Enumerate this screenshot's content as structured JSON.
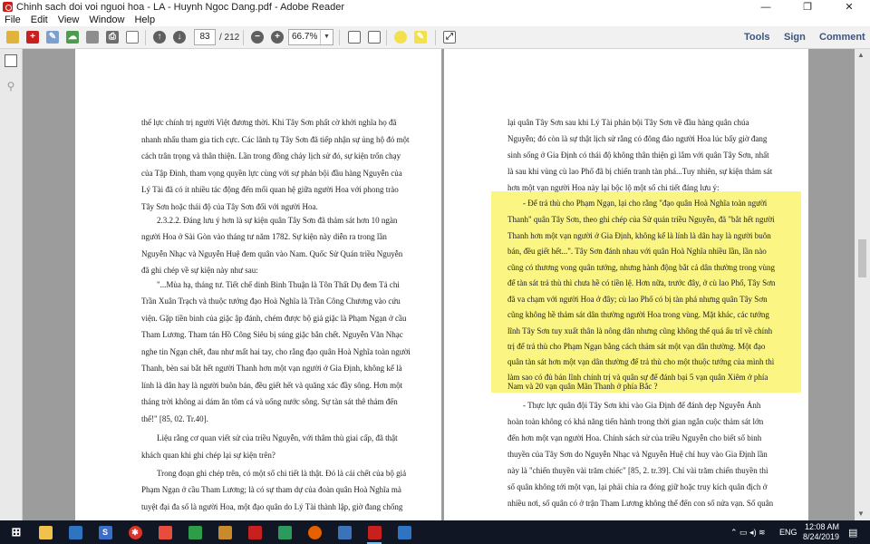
{
  "window": {
    "title": "Chinh sach doi voi nguoi hoa - LA - Huynh Ngoc Dang.pdf - Adobe Reader",
    "controls": {
      "minimize": "—",
      "maximize": "❐",
      "close": "✕"
    }
  },
  "menu": [
    "File",
    "Edit",
    "View",
    "Window",
    "Help"
  ],
  "toolbar": {
    "current_page": "83",
    "total_pages": "/ 212",
    "zoom": "66.7%",
    "tools_label": "Tools",
    "sign_label": "Sign",
    "comment_label": "Comment"
  },
  "colors": {
    "highlight": "#fbf583",
    "pdf_red": "#c8201e",
    "taskbar": "#101623"
  },
  "left_page": [
    "thế lực chính trị người Việt đương thời. Khi Tây Sơn phất cờ khởi nghĩa họ đã",
    "nhanh nhẩu tham gia tích cực. Các lãnh tụ Tây Sơn đã tiếp nhận sự ủng hộ đó một",
    "cách trân trọng và thân thiện. Lần trong đồng chảy lịch sử đó, sự kiện trốn chạy",
    "của Tập Đình, tham vọng quyền lực cùng với sự phản bội đầu hàng Nguyễn của",
    "Lý Tài đã có ít nhiều tác động đến mối quan hệ giữa người Hoa với phong trào",
    "Tây Sơn hoặc thái độ của Tây Sơn đối với người Hoa.",
    "2.3.2.2. Đáng lưu ý hơn là sự kiện quân Tây Sơn đã thảm sát hơn 10 ngàn",
    "người Hoa ở Sài Gòn vào tháng tư năm 1782. Sự kiện này diễn ra trong lần",
    "Nguyễn Nhạc và Nguyễn Huệ đem quân vào Nam. Quốc Sử Quán triều Nguyễn",
    "đã ghi chép về sự kiện này như sau:",
    "\"...Mùa hạ, tháng tư. Tiết chế dinh Bình Thuận là Tôn Thất Dụ đem Tả chi",
    "Trần Xuân Trạch và thuộc tướng đạo Hoà Nghĩa là Trần Công Chương vào cứu",
    "viện. Gặp tiền binh của giặc ập đánh, chém được bộ giả giặc là Phạm Ngạn ở cầu",
    "Tham Lương. Tham tán Hồ Công Siêu bị súng giặc bắn chết. Nguyễn Văn Nhạc",
    "nghe tin Ngạn chết, đau như mất hai tay, cho rằng đạo quân Hoà Nghĩa toàn người",
    "Thanh, bèn sai bắt hết người Thanh hơn một vạn người ở Gia Định, không kể là",
    "lính là dân hay là người buôn bán, đều giết hết và quăng xác đầy sông. Hơn một",
    "tháng trời không ai dám ăn tôm cá và uống nước sông. Sự tàn sát thê thảm đến",
    "thế!\" [85, 02. Tr.40].",
    "Liệu rằng cơ quan viết sử của triều Nguyễn, với thâm thù giai cấp, đã thật",
    "khách quan khi ghi chép lại sự kiện trên?",
    "Trong đoạn ghi chép trên, có một số chi tiết là thật. Đó là cái chết của bộ giả",
    "Phạm Ngạn ở cầu Tham Lương; là có sự tham dự của đoàn quân Hoà Nghĩa mà",
    "tuyệt đại đa số là người Hoa, một đạo quân do Lý Tài thành lập, giờ đang chống"
  ],
  "right_page": [
    "lại quân Tây Sơn sau khi Lý Tài phản bội Tây Sơn về đầu hàng quân chúa",
    "Nguyễn; đó còn là sự thật lịch sử rằng có đông đảo người Hoa lúc bấy giờ đang",
    "sinh sống ở Gia Định có  thái độ không thân thiện gì lắm với quân Tây Sơn, nhất",
    "là sau khi vùng cù lao Phố đã bị chiến tranh tàn phá...Tuy nhiên, sự kiện thảm sát",
    "hơn một vạn người Hoa này lại bộc lộ một số chi tiết đáng lưu ý:",
    "- Để trả thù cho Phạm Ngạn, lại cho rằng \"đạo quân Hoà Nghĩa toàn người",
    "Thanh\" quân Tây Sơn, theo ghi chép của Sử quán triều Nguyễn, đã \"bắt hết người",
    "Thanh hơn một vạn người ở Gia Định, không kể là lính là dân hay là người buôn",
    "bán, đều giết hết...\". Tây Sơn đánh nhau với quân Hoà Nghĩa nhiều lần, lần nào",
    "cũng có thương vong quân tướng, nhưng hành động bắt cả dân thường trong vùng",
    "để tàn sát trả thù thì chưa hề có tiền lệ. Hơn nữa, trước đây, ở cù lao Phố, Tây Sơn",
    "đã va chạm với người Hoa ở đây; cù lao Phố có bị tàn phá nhưng quân Tây Sơn",
    "cũng không hề thảm sát dân thường người Hoa trong vùng. Mặt khác, các tướng",
    "lĩnh Tây Sơn tuy xuất thân là nông dân nhưng cũng không thể quá ấu trĩ về chính",
    "trị để trả thù cho Phạm Ngạn bằng cách thảm sát một vạn dân thường. Một đạo",
    "quân tàn sát hơn một vạn dân thường để trả thù cho một thuộc tướng của mình thì",
    "làm sao có đủ bản lĩnh chính trị và quân sự để đánh bại 5 vạn quân Xiêm ở phía",
    "Nam và 20 vạn quân Mãn Thanh ở phía Bắc ?",
    "- Thực lực quân đội Tây Sơn khi vào Gia Định để đánh dẹp Nguyễn Ánh",
    "hoàn toàn không có khả năng tiến hành trong thời gian ngắn cuộc thảm sát lớn",
    "đến hơn một vạn người Hoa. Chính sách sử của triều Nguyễn cho biết số binh",
    "thuyền của Tây Sơn do Nguyễn Nhạc và Nguyễn Huệ chỉ huy vào Gia Định lần",
    "này là \"chiến thuyền vài trăm chiếc\" [85, 2. tr.39]. Chỉ vài trăm chiến thuyền thì",
    "số quân không tới một vạn, lại phải chia ra đóng giữ hoặc truy kích quân địch ở",
    "nhiều nơi, số quân có ở trận Tham Lương không thể đến con số nửa vạn. Số quân"
  ],
  "taskbar": {
    "language": "ENG",
    "time": "12:08 AM",
    "date": "8/24/2019"
  }
}
